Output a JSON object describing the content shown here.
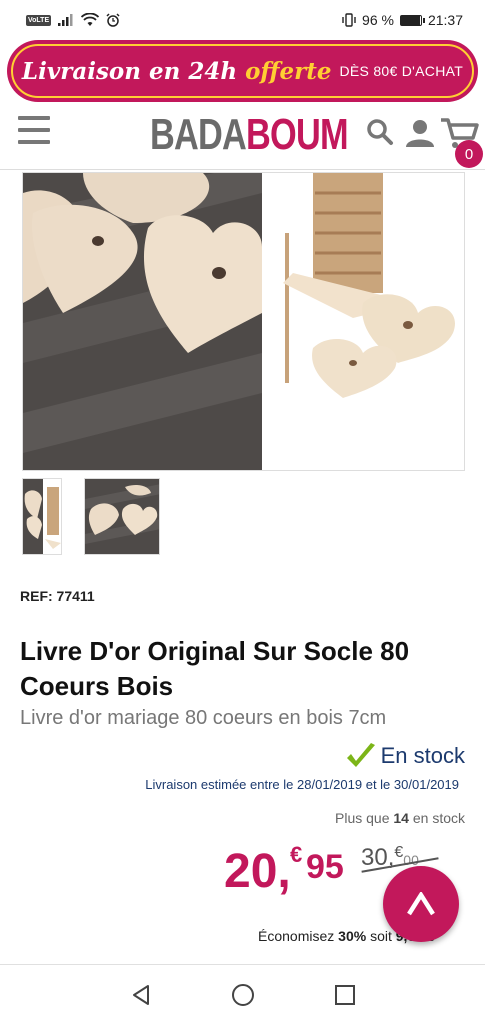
{
  "status_bar": {
    "volte": "VoLTE",
    "battery_pct": "96 %",
    "battery_level": 0.96,
    "time": "21:37"
  },
  "promo": {
    "script_text": "Livraison en 24h",
    "highlight": "offerte",
    "condition": "DÈS 80€ D'ACHAT"
  },
  "header": {
    "logo_part1": "BADA",
    "logo_part2": "BOUM",
    "cart_count": "0"
  },
  "product": {
    "ref": "REF: 77411",
    "title": "Livre D'or Original Sur Socle 80 Coeurs Bois",
    "subtitle": "Livre d'or mariage 80 coeurs en bois 7cm",
    "stock_status": "En stock",
    "delivery_prefix": "Livraison estimée entre le",
    "delivery_start": "28/01/2019",
    "delivery_mid": "et le",
    "delivery_end": "30/01/2019",
    "remaining_prefix": "Plus que",
    "remaining_count": "14",
    "remaining_suffix": "en stock",
    "price_int": "20",
    "price_cur": "€",
    "price_dec": "95",
    "price_comma": ",",
    "old_price_int": "30,",
    "old_price_cur": "€",
    "old_price_dec": "00",
    "savings_prefix": "Économisez",
    "savings_pct": "30%",
    "savings_mid": "soit",
    "savings_amount": "9,05 €"
  },
  "colors": {
    "brand": "#c2185b",
    "accent_yellow": "#ffcf33",
    "stock_blue": "#1c3a6e",
    "stock_check": "#7cb518"
  }
}
